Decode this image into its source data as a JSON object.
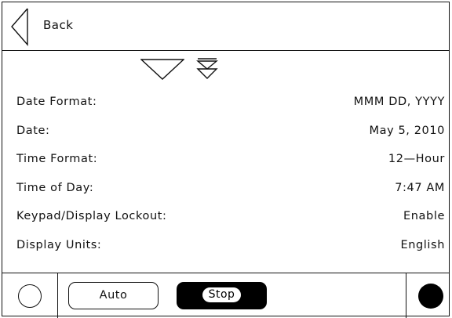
{
  "header": {
    "back_label": "Back"
  },
  "settings": [
    {
      "label": "Date Format:",
      "value": "MMM DD, YYYY"
    },
    {
      "label": "Date:",
      "value": "May 5, 2010"
    },
    {
      "label": "Time Format:",
      "value": "12—Hour"
    },
    {
      "label": "Time of Day:",
      "value": "7:47 AM"
    },
    {
      "label": "Keypad/Display Lockout:",
      "value": "Enable"
    },
    {
      "label": "Display Units:",
      "value": "English"
    }
  ],
  "footer": {
    "auto_label": "Auto",
    "stop_label": "Stop"
  }
}
